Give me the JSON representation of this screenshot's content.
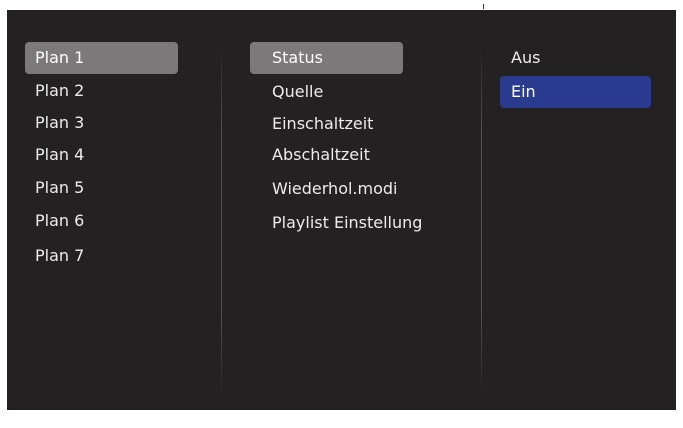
{
  "plans": {
    "items": [
      {
        "label": "Plan 1"
      },
      {
        "label": "Plan 2"
      },
      {
        "label": "Plan 3"
      },
      {
        "label": "Plan 4"
      },
      {
        "label": "Plan 5"
      },
      {
        "label": "Plan 6"
      },
      {
        "label": "Plan 7"
      }
    ],
    "selected_index": 0
  },
  "settings": {
    "items": [
      {
        "label": "Status"
      },
      {
        "label": "Quelle"
      },
      {
        "label": "Einschaltzeit"
      },
      {
        "label": "Abschaltzeit"
      },
      {
        "label": "Wiederhol.modi"
      },
      {
        "label": "Playlist Einstellung"
      }
    ],
    "selected_index": 0
  },
  "options": {
    "items": [
      {
        "label": "Aus"
      },
      {
        "label": "Ein"
      }
    ],
    "active_index": 1
  },
  "colors": {
    "background": "#242122",
    "selected": "#7b797a",
    "active": "#2a3a8f",
    "text": "#ececec"
  }
}
